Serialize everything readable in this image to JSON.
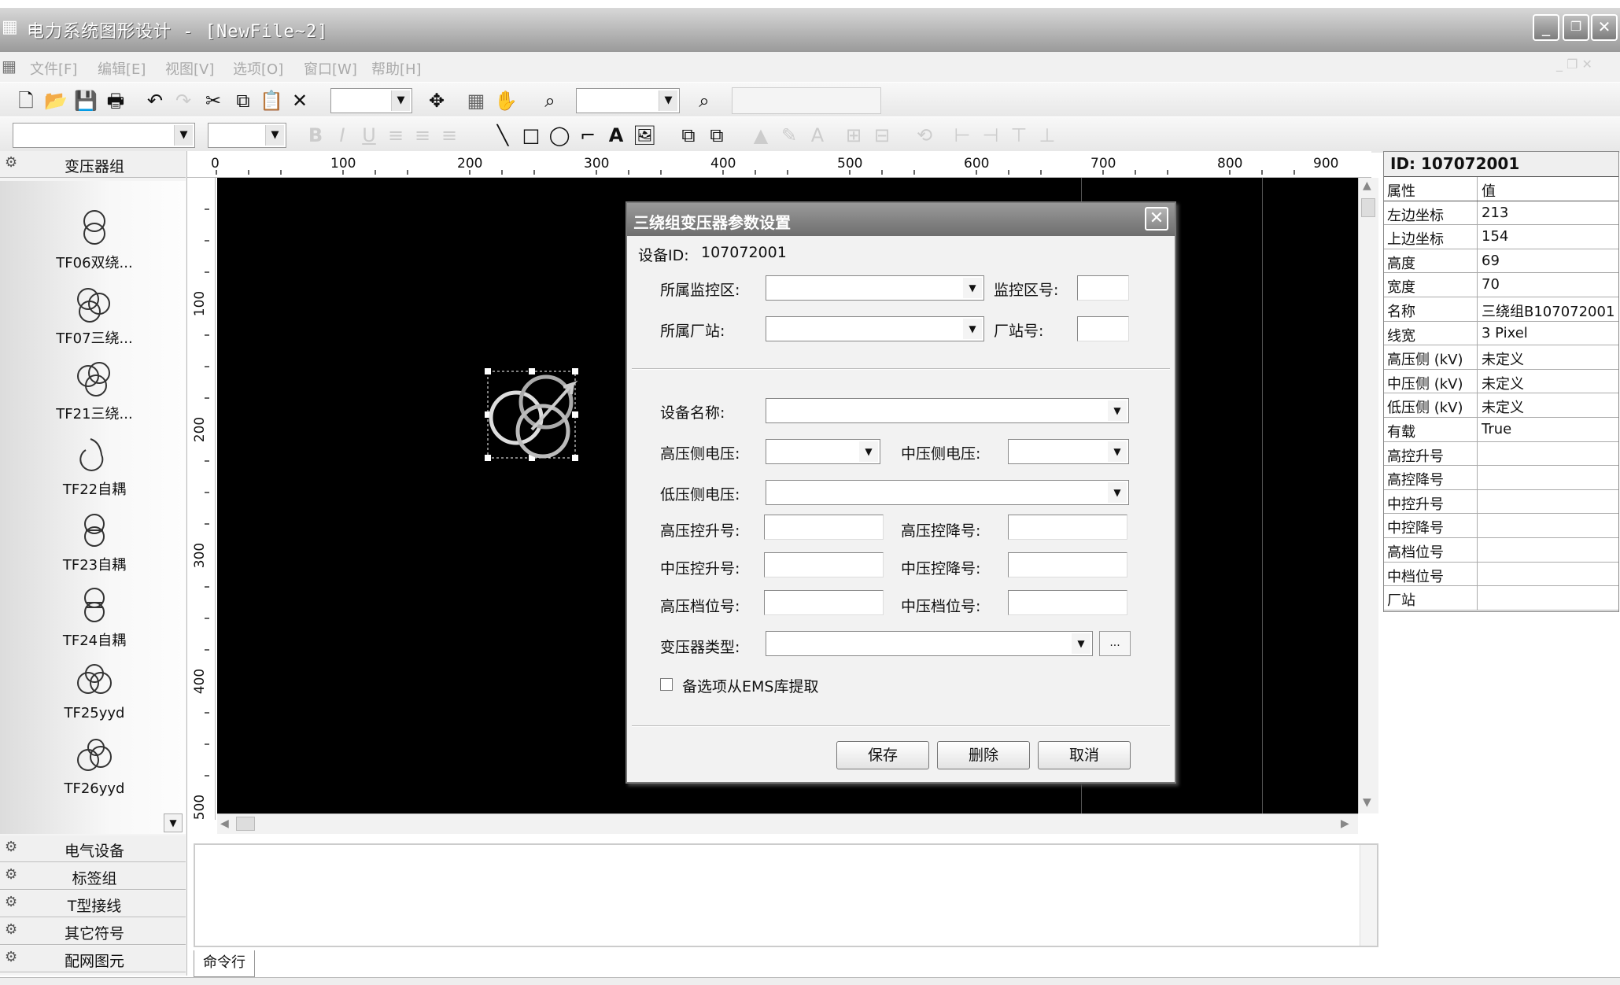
{
  "window": {
    "title": "电力系统图形设计 - [NewFile~2]",
    "min_glyph": "_",
    "restore_glyph": "❐",
    "close_glyph": "✕"
  },
  "menu": [
    "文件[F]",
    "编辑[E]",
    "视图[V]",
    "选项[O]",
    "窗口[W]",
    "帮助[H]"
  ],
  "left_panel": {
    "active_group": "变压器组",
    "symbols": [
      {
        "label": "TF06双绕...",
        "icon": "two-winding-transformer-icon"
      },
      {
        "label": "TF07三绕...",
        "icon": "three-winding-transformer-icon"
      },
      {
        "label": "TF21三绕...",
        "icon": "three-winding-transformer-icon"
      },
      {
        "label": "TF22自耦",
        "icon": "auto-transformer-icon"
      },
      {
        "label": "TF23自耦",
        "icon": "auto-transformer-icon"
      },
      {
        "label": "TF24自耦",
        "icon": "auto-transformer-icon"
      },
      {
        "label": "TF25yyd",
        "icon": "yyd-transformer-icon"
      },
      {
        "label": "TF26yyd",
        "icon": "yyd-transformer-icon"
      }
    ],
    "groups": [
      "电气设备",
      "标签组",
      "T型接线",
      "其它符号",
      "配网图元"
    ]
  },
  "ruler": {
    "h_ticks": [
      "0",
      "100",
      "200",
      "300",
      "400",
      "500",
      "600",
      "700",
      "800",
      "900"
    ],
    "v_ticks": [
      "100",
      "200",
      "300",
      "400",
      "500"
    ]
  },
  "command_tab": "命令行",
  "properties": {
    "id_header": "ID: 107072001",
    "col_name": "属性",
    "col_value": "值",
    "rows": [
      {
        "k": "左边坐标",
        "v": "213"
      },
      {
        "k": "上边坐标",
        "v": "154"
      },
      {
        "k": "高度",
        "v": "69"
      },
      {
        "k": "宽度",
        "v": "70"
      },
      {
        "k": "名称",
        "v": "三绕组B107072001"
      },
      {
        "k": "线宽",
        "v": "3 Pixel"
      },
      {
        "k": "高压侧 (kV)",
        "v": "未定义"
      },
      {
        "k": "中压侧 (kV)",
        "v": "未定义"
      },
      {
        "k": "低压侧 (kV)",
        "v": "未定义"
      },
      {
        "k": "有载",
        "v": "True"
      },
      {
        "k": "高控升号",
        "v": ""
      },
      {
        "k": "高控降号",
        "v": ""
      },
      {
        "k": "中控升号",
        "v": ""
      },
      {
        "k": "中控降号",
        "v": ""
      },
      {
        "k": "高档位号",
        "v": ""
      },
      {
        "k": "中档位号",
        "v": ""
      },
      {
        "k": "厂站",
        "v": ""
      }
    ]
  },
  "dialog": {
    "title": "三绕组变压器参数设置",
    "device_id_label": "设备ID:",
    "device_id": "107072001",
    "monitor_area_label": "所属监控区:",
    "monitor_no_label": "监控区号:",
    "station_label": "所属厂站:",
    "station_no_label": "厂站号:",
    "device_name_label": "设备名称:",
    "hv_label": "高压侧电压:",
    "mv_label": "中压侧电压:",
    "lv_label": "低压侧电压:",
    "hv_up_label": "高压控升号:",
    "hv_down_label": "高压控降号:",
    "mv_up_label": "中压控升号:",
    "mv_down_label": "中压控降号:",
    "hv_tap_label": "高压档位号:",
    "mv_tap_label": "中压档位号:",
    "type_label": "变压器类型:",
    "browse_label": "...",
    "ems_checkbox_label": "备选项从EMS库提取",
    "ems_checked": false,
    "save": "保存",
    "delete": "删除",
    "cancel": "取消"
  }
}
